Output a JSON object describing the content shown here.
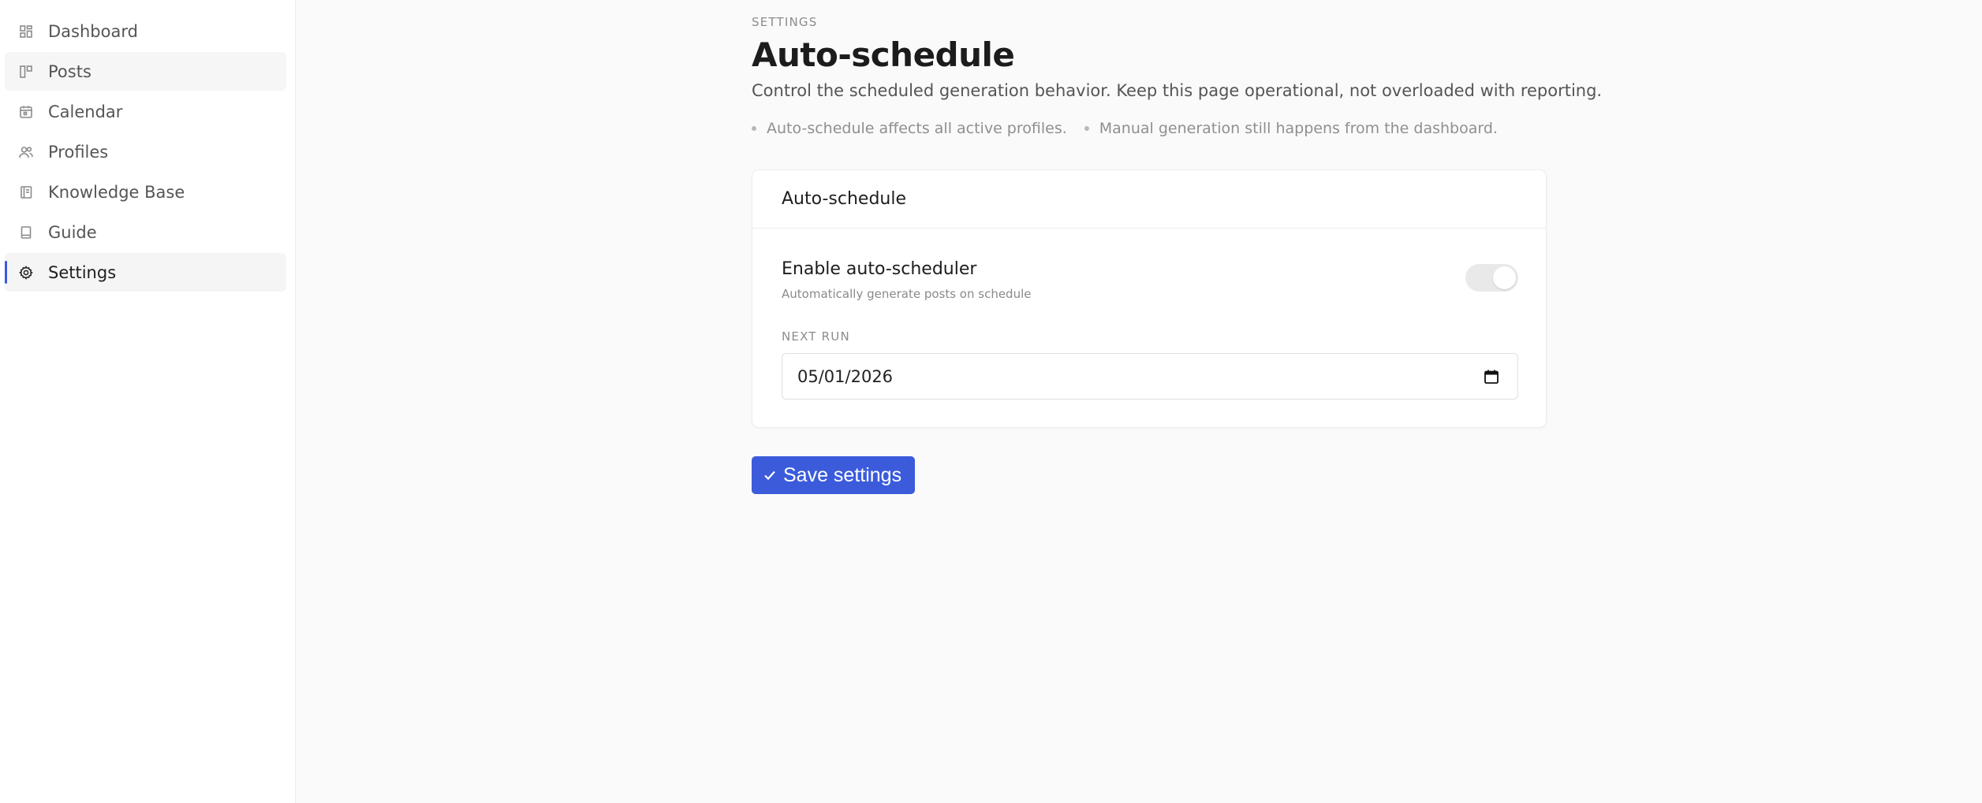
{
  "sidebar": {
    "items": [
      {
        "label": "Dashboard",
        "icon": "dashboard-icon",
        "active": false
      },
      {
        "label": "Posts",
        "icon": "posts-icon",
        "active": false
      },
      {
        "label": "Calendar",
        "icon": "calendar-icon",
        "active": false
      },
      {
        "label": "Profiles",
        "icon": "users-icon",
        "active": false
      },
      {
        "label": "Knowledge Base",
        "icon": "book-icon",
        "active": false
      },
      {
        "label": "Guide",
        "icon": "guide-icon",
        "active": false
      },
      {
        "label": "Settings",
        "icon": "gear-icon",
        "active": true
      }
    ]
  },
  "header": {
    "eyebrow": "SETTINGS",
    "title": "Auto-schedule",
    "subtitle": "Control the scheduled generation behavior. Keep this page operational, not overloaded with reporting.",
    "bullets": [
      "Auto-schedule affects all active profiles.",
      "Manual generation still happens from the dashboard."
    ]
  },
  "card": {
    "title": "Auto-schedule",
    "toggle": {
      "label": "Enable auto-scheduler",
      "description": "Automatically generate posts on schedule",
      "enabled": true
    },
    "next_run": {
      "label": "NEXT RUN",
      "value": "05/01/2026"
    }
  },
  "actions": {
    "save_label": "Save settings"
  },
  "colors": {
    "accent": "#3b5bdb",
    "background": "#fafafa",
    "sidebar_bg": "#ffffff"
  }
}
